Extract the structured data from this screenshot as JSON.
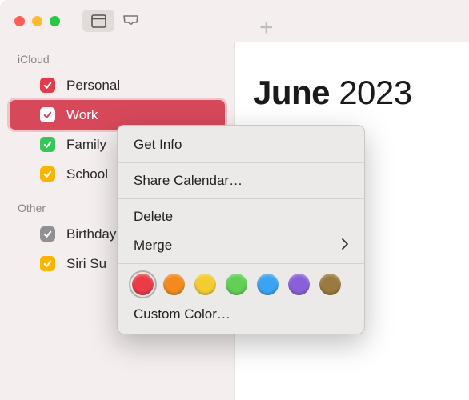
{
  "toolbar": {
    "traffic": {
      "close": "#ff5f57",
      "min": "#febc2e",
      "max": "#28c840"
    }
  },
  "sidebar": {
    "sections": [
      {
        "label": "iCloud",
        "items": [
          {
            "label": "Personal",
            "color": "#e23b4a",
            "checked": true,
            "selected": false
          },
          {
            "label": "Work",
            "color": "#ffffff",
            "boxbg": "#ffffff",
            "tick": "#d7495a",
            "checked": true,
            "selected": true
          },
          {
            "label": "Family",
            "color": "#32c758",
            "checked": true,
            "selected": false
          },
          {
            "label": "School",
            "color": "#f7b500",
            "checked": true,
            "selected": false
          }
        ]
      },
      {
        "label": "Other",
        "items": [
          {
            "label": "Birthdays",
            "color": "#8f8f94",
            "checked": true,
            "selected": false
          },
          {
            "label": "Siri Suggestions",
            "color": "#f7b500",
            "checked": true,
            "selected": false,
            "display": "Siri Su"
          }
        ]
      }
    ]
  },
  "content": {
    "month": "June",
    "year": "2023"
  },
  "menu": {
    "get_info": "Get Info",
    "share": "Share Calendar…",
    "delete": "Delete",
    "merge": "Merge",
    "custom": "Custom Color…",
    "colors": [
      {
        "hex": "#ea3b46",
        "selected": true
      },
      {
        "hex": "#f28a1f"
      },
      {
        "hex": "#f3cc2f"
      },
      {
        "hex": "#62cf56"
      },
      {
        "hex": "#3aa3f2"
      },
      {
        "hex": "#8a60d8"
      },
      {
        "hex": "#9a7a3f"
      }
    ]
  }
}
